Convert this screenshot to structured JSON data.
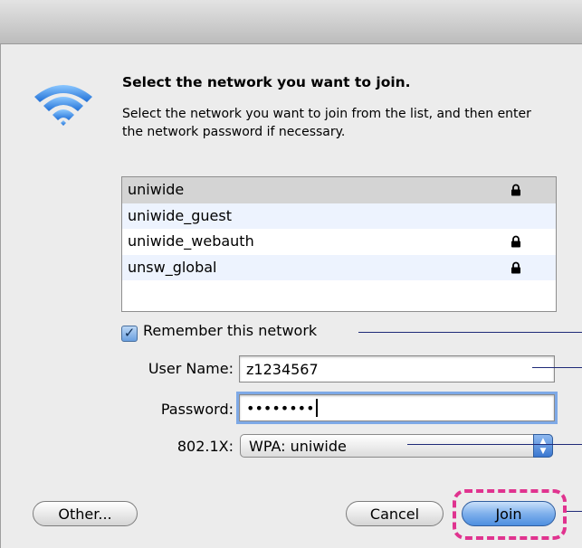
{
  "dialog": {
    "heading": "Select the network you want to join.",
    "description": "Select the network you want to join from the list, and then enter the network password if necessary."
  },
  "networks": [
    {
      "name": "uniwide",
      "secured": true,
      "selected": true
    },
    {
      "name": "uniwide_guest",
      "secured": false,
      "selected": false
    },
    {
      "name": "uniwide_webauth",
      "secured": true,
      "selected": false
    },
    {
      "name": "unsw_global",
      "secured": true,
      "selected": false
    }
  ],
  "remember": {
    "label": "Remember this network",
    "checked": true
  },
  "username": {
    "label": "User Name:",
    "value": "z1234567"
  },
  "password": {
    "label": "Password:",
    "value": "••••••••"
  },
  "dot1x": {
    "label": "802.1X:",
    "value": "WPA: uniwide"
  },
  "buttons": {
    "other": "Other...",
    "cancel": "Cancel",
    "join": "Join"
  },
  "colors": {
    "accent": "#4e8fe0",
    "highlight": "#e0338f",
    "callout": "#1f2a78"
  }
}
